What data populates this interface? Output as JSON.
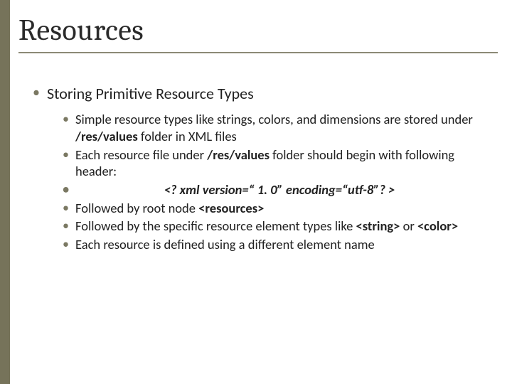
{
  "title": "Resources",
  "section": "Storing Primitive Resource Types",
  "b1_pre": "Simple resource types like strings, colors, and dimensions are stored under ",
  "b1_bold": "/res/values",
  "b1_post": " folder in XML files",
  "b2_pre": "Each resource file under ",
  "b2_bold": "/res/values",
  "b2_post": " folder should begin with following header:",
  "xml": "<? xml version=“ 1. 0” encoding=“utf-8”? >",
  "b3_pre": "Followed by root node ",
  "b3_bold": "<resources>",
  "b4_pre": "Followed by the specific resource element types like ",
  "b4_bold1": "<string>",
  "b4_mid": " or ",
  "b4_bold2": "<color>",
  "b5": "Each resource is defined using a different element name"
}
